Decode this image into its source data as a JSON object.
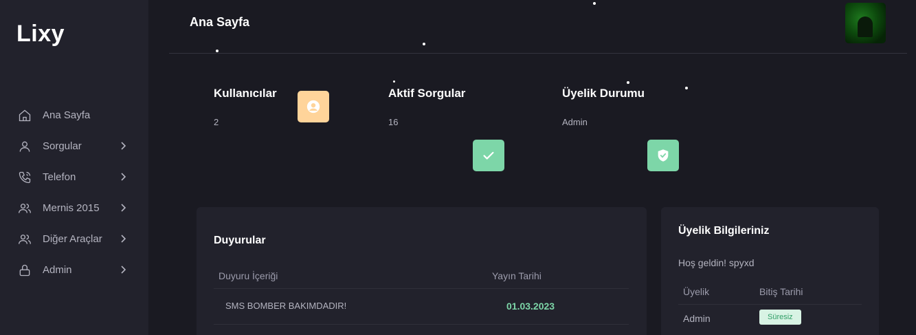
{
  "brand": "Lixy",
  "header": {
    "title": "Ana Sayfa"
  },
  "sidebar": {
    "items": [
      {
        "label": "Ana Sayfa",
        "icon": "home-icon"
      },
      {
        "label": "Sorgular",
        "icon": "user-icon"
      },
      {
        "label": "Telefon",
        "icon": "phone-icon"
      },
      {
        "label": "Mernis 2015",
        "icon": "users-icon"
      },
      {
        "label": "Diğer Araçlar",
        "icon": "users-icon"
      },
      {
        "label": "Admin",
        "icon": "lock-icon"
      }
    ]
  },
  "stats": [
    {
      "title": "Kullanıcılar",
      "value": "2",
      "icon": "user-circle-icon",
      "color": "#ffd49a"
    },
    {
      "title": "Aktif Sorgular",
      "value": "16",
      "icon": "check-icon",
      "color": "#7dd6a8"
    },
    {
      "title": "Üyelik Durumu",
      "value": "Admin",
      "icon": "shield-check-icon",
      "color": "#7dd6a8"
    }
  ],
  "announcements": {
    "title": "Duyurular",
    "columns": [
      "Duyuru İçeriği",
      "Yayın Tarihi"
    ],
    "rows": [
      {
        "content": "SMS BOMBER BAKIMDADIR!",
        "date": "01.03.2023"
      }
    ]
  },
  "membership": {
    "title": "Üyelik Bilgileriniz",
    "greeting": "Hoş geldin! spyxd",
    "columns": [
      "Üyelik",
      "Bitiş Tarihi"
    ],
    "rows": [
      {
        "type": "Admin",
        "expiry": "Süresiz"
      }
    ]
  },
  "colors": {
    "background": "#1a1a22",
    "sidebar": "#22222c",
    "accent_green": "#7dd6a8",
    "accent_orange": "#ffd49a"
  }
}
